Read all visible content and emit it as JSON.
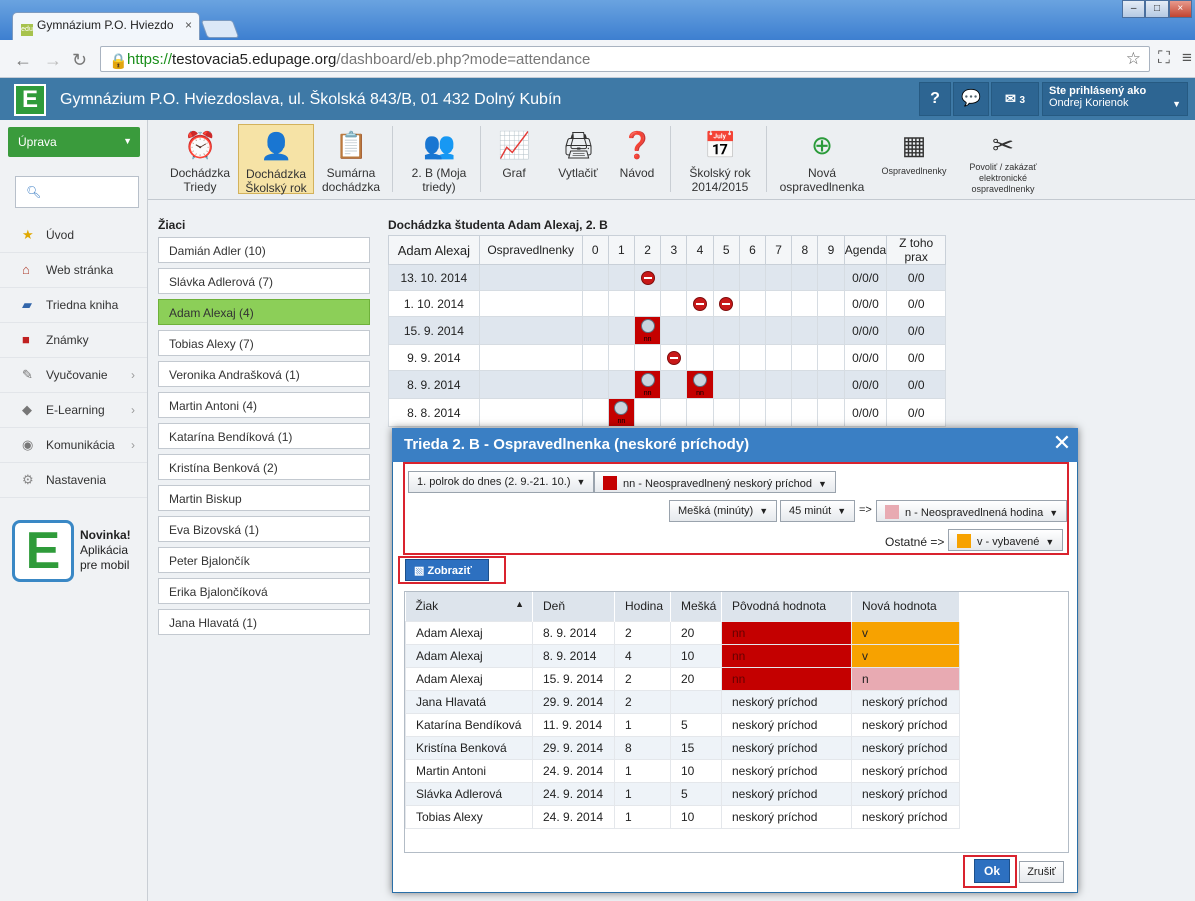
{
  "browser": {
    "tab_title": "Gymnázium P.O. Hviezdo",
    "tab_favicon": "edu",
    "url_scheme": "https://",
    "url_host": "testovacia5.edupage.org",
    "url_path": "/dashboard/eb.php?mode=attendance"
  },
  "header": {
    "logo": "E",
    "school": "Gymnázium P.O. Hviezdoslava, ul. Školská 843/B, 01 432 Dolný Kubín",
    "help": "?",
    "messages_count": "3",
    "user_label": "Ste prihlásený ako",
    "user_name": "Ondrej Korienok"
  },
  "sidebar": {
    "uprava": "Úprava",
    "items": [
      {
        "label": "Úvod",
        "icon": "star-icon"
      },
      {
        "label": "Web stránka",
        "icon": "house-icon"
      },
      {
        "label": "Triedna kniha",
        "icon": "book-icon"
      },
      {
        "label": "Známky",
        "icon": "grades-icon"
      },
      {
        "label": "Vyučovanie",
        "icon": "teaching-icon"
      },
      {
        "label": "E-Learning",
        "icon": "elearning-icon"
      },
      {
        "label": "Komunikácia",
        "icon": "communication-icon"
      },
      {
        "label": "Nastavenia",
        "icon": "settings-icon"
      }
    ],
    "promo_title": "Novinka!",
    "promo_line1": "Aplikácia",
    "promo_line2": "pre mobil"
  },
  "ribbon": [
    {
      "line1": "Dochádzka",
      "line2": "Triedy"
    },
    {
      "line1": "Dochádzka",
      "line2": "Školský rok"
    },
    {
      "line1": "Sumárna",
      "line2": "dochádzka"
    },
    {
      "line1": "2. B (Moja",
      "line2": "triedy)"
    },
    {
      "line1": "Graf",
      "line2": ""
    },
    {
      "line1": "Vytlačiť",
      "line2": ""
    },
    {
      "line1": "Návod",
      "line2": ""
    },
    {
      "line1": "Školský rok",
      "line2": "2014/2015"
    },
    {
      "line1": "Nová",
      "line2": "ospravedlnenka"
    },
    {
      "line1": "Ospravedlnenky",
      "line2": ""
    },
    {
      "line1": "Povoliť / zakázať",
      "line2": "elektronické",
      "line3": "ospravedlnenky"
    }
  ],
  "students": {
    "title": "Žiaci",
    "list": [
      "Damián Adler (10)",
      "Slávka Adlerová (7)",
      "Adam Alexaj (4)",
      "Tobias Alexy (7)",
      "Veronika Andrašková (1)",
      "Martin Antoni (4)",
      "Katarína Bendíková (1)",
      "Kristína Benková (2)",
      "Martin Biskup",
      "Eva Bizovská (1)",
      "Peter Bjalončík",
      "Erika Bjalončíková",
      "Jana Hlavatá (1)"
    ]
  },
  "attendance": {
    "title": "Dochádzka študenta Adam Alexaj, 2. B",
    "headers": [
      "Adam Alexaj",
      "Ospravedlnenky",
      "0",
      "1",
      "2",
      "3",
      "4",
      "5",
      "6",
      "7",
      "8",
      "9",
      "Agenda",
      "Z toho prax"
    ],
    "rows": [
      {
        "date": "13. 10. 2014",
        "agenda": "0/0/0",
        "prax": "0/0"
      },
      {
        "date": "1. 10. 2014",
        "agenda": "0/0/0",
        "prax": "0/0"
      },
      {
        "date": "15. 9. 2014",
        "agenda": "0/0/0",
        "prax": "0/0"
      },
      {
        "date": "9. 9. 2014",
        "agenda": "0/0/0",
        "prax": "0/0"
      },
      {
        "date": "8. 9. 2014",
        "agenda": "0/0/0",
        "prax": "0/0"
      },
      {
        "date": "8. 8. 2014",
        "agenda": "0/0/0",
        "prax": "0/0"
      }
    ],
    "nn": "nn"
  },
  "dialog": {
    "title": "Trieda 2. B - Ospravedlnenka (neskoré príchody)",
    "period": "1. polrok do dnes (2. 9.-21. 10.)",
    "type": "nn - Neospravedlnený neskorý príchod",
    "late_by": "Mešká (minúty)",
    "minutes": "45 minút",
    "arrow": "=>",
    "result": "n - Neospravedlnená hodina",
    "other_label": "Ostatné =>",
    "other_value": "v - vybavené",
    "show_btn": "Zobraziť",
    "columns": [
      "Žiak",
      "Deň",
      "Hodina",
      "Mešká",
      "Pôvodná hodnota",
      "Nová hodnota"
    ],
    "rows": [
      [
        "Adam Alexaj",
        "8. 9. 2014",
        "2",
        "20",
        "nn",
        "v"
      ],
      [
        "Adam Alexaj",
        "8. 9. 2014",
        "4",
        "10",
        "nn",
        "v"
      ],
      [
        "Adam Alexaj",
        "15. 9. 2014",
        "2",
        "20",
        "nn",
        "n"
      ],
      [
        "Jana Hlavatá",
        "29. 9. 2014",
        "2",
        "",
        "neskorý príchod",
        "neskorý príchod"
      ],
      [
        "Katarína Bendíková",
        "11. 9. 2014",
        "1",
        "5",
        "neskorý príchod",
        "neskorý príchod"
      ],
      [
        "Kristína Benková",
        "29. 9. 2014",
        "8",
        "15",
        "neskorý príchod",
        "neskorý príchod"
      ],
      [
        "Martin Antoni",
        "24. 9. 2014",
        "1",
        "10",
        "neskorý príchod",
        "neskorý príchod"
      ],
      [
        "Slávka Adlerová",
        "24. 9. 2014",
        "1",
        "5",
        "neskorý príchod",
        "neskorý príchod"
      ],
      [
        "Tobias Alexy",
        "24. 9. 2014",
        "1",
        "10",
        "neskorý príchod",
        "neskorý príchod"
      ]
    ],
    "ok": "Ok",
    "cancel": "Zrušiť"
  },
  "colors": {
    "header": "#3e79a6",
    "green": "#3a9b3c",
    "nn_red": "#c40000",
    "orange": "#f7a200",
    "pink": "#e8aab2",
    "highlight_box": "#d9232e"
  }
}
